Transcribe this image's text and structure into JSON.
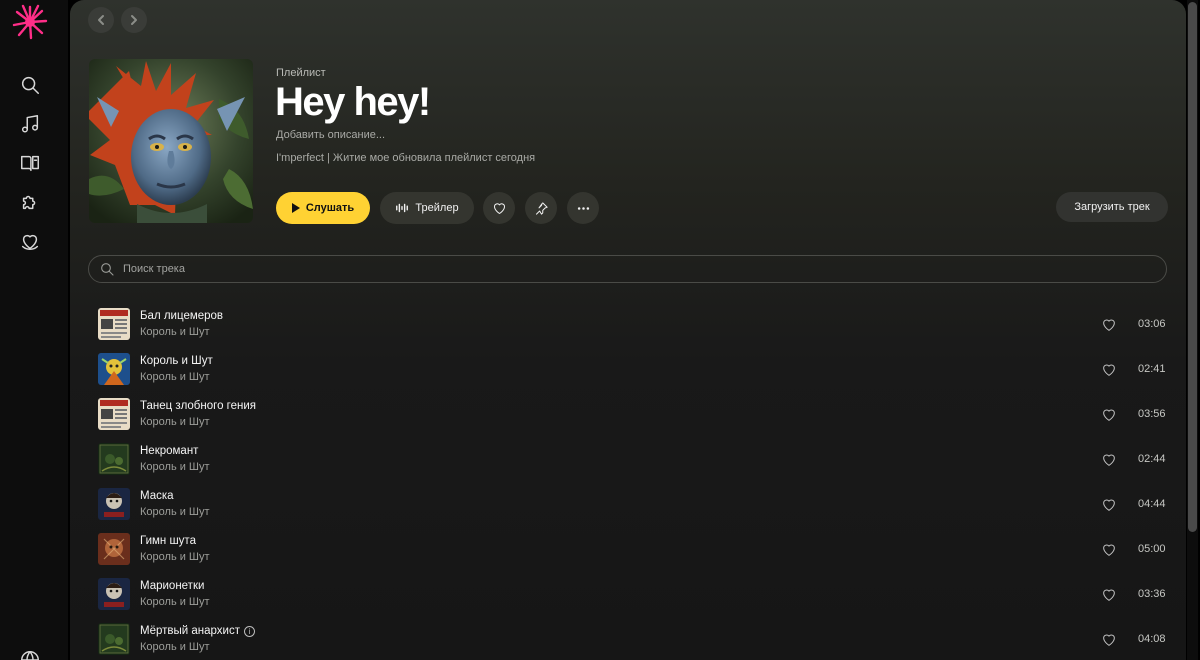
{
  "colors": {
    "accent": "#ffd233",
    "logo": "#ff2e88",
    "background": "#161616",
    "rail": "#0d0d0d"
  },
  "sidebar": {
    "items": [
      {
        "icon": "search-icon"
      },
      {
        "icon": "music-note-icon"
      },
      {
        "icon": "library-book-icon"
      },
      {
        "icon": "puzzle-icon"
      },
      {
        "icon": "heart-collection-icon"
      },
      {
        "icon": "globe-icon"
      }
    ]
  },
  "nav": {
    "back_icon": "chevron-left-icon",
    "forward_icon": "chevron-right-icon"
  },
  "playlist": {
    "type_label": "Плейлист",
    "title": "Hey hey!",
    "description_placeholder": "Добавить описание...",
    "meta": "I'mperfect | Житие мое обновила плейлист сегодня"
  },
  "actions": {
    "play_label": "Слушать",
    "trailer_label": "Трейлер",
    "upload_label": "Загрузить трек"
  },
  "search": {
    "placeholder": "Поиск трека",
    "value": ""
  },
  "tracks": [
    {
      "title": "Бал лицемеров",
      "artist": "Король и Шут",
      "duration": "03:06",
      "cover": "newspaper"
    },
    {
      "title": "Король и Шут",
      "artist": "Король и Шут",
      "duration": "02:41",
      "cover": "blue-jester"
    },
    {
      "title": "Танец злобного гения",
      "artist": "Король и Шут",
      "duration": "03:56",
      "cover": "newspaper"
    },
    {
      "title": "Некромант",
      "artist": "Король и Шут",
      "duration": "02:44",
      "cover": "green-dark"
    },
    {
      "title": "Маска",
      "artist": "Король и Шут",
      "duration": "04:44",
      "cover": "blue-face"
    },
    {
      "title": "Гимн шута",
      "artist": "Король и Шут",
      "duration": "05:00",
      "cover": "red-brown"
    },
    {
      "title": "Марионетки",
      "artist": "Король и Шут",
      "duration": "03:36",
      "cover": "blue-face"
    },
    {
      "title": "Мёртвый анархист",
      "artist": "Король и Шут",
      "duration": "04:08",
      "cover": "green-dark",
      "info": "i"
    }
  ]
}
